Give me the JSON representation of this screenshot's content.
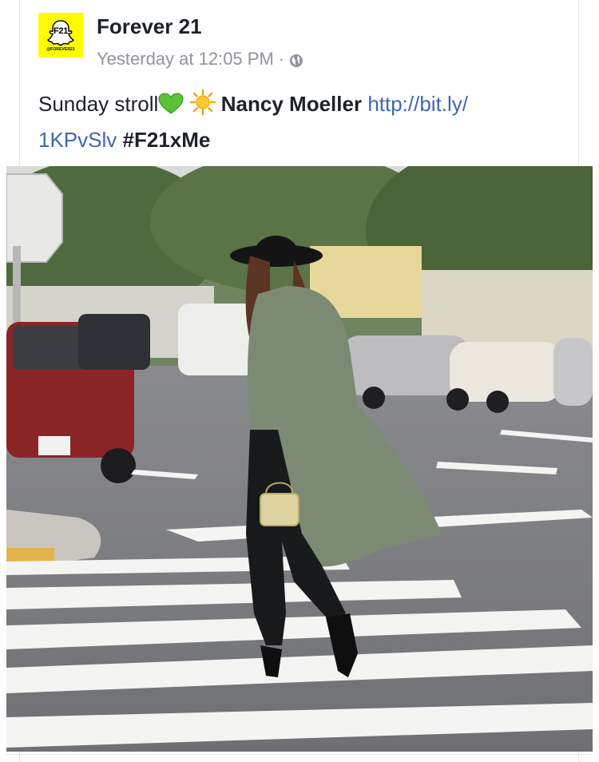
{
  "post": {
    "avatar": {
      "label": "F21",
      "handle": "@FOREVER21",
      "bg_color": "#fffc00"
    },
    "page_name": "Forever 21",
    "timestamp": "Yesterday at 12:05 PM",
    "separator": "·",
    "privacy_icon": "globe-icon",
    "text": {
      "caption": "Sunday stroll",
      "emoji_1": "green-heart-icon",
      "emoji_2": "sun-icon",
      "tagged_person": "Nancy Moeller",
      "link_part1": "http://bit.ly/",
      "link_part2": "1KPvSlv",
      "hashtag": "#F21xMe"
    },
    "image": {
      "subject": "woman-crossing-street-photo"
    },
    "colors": {
      "name_text": "#1d2129",
      "meta_text": "#90949c",
      "link": "#4267b2"
    }
  }
}
